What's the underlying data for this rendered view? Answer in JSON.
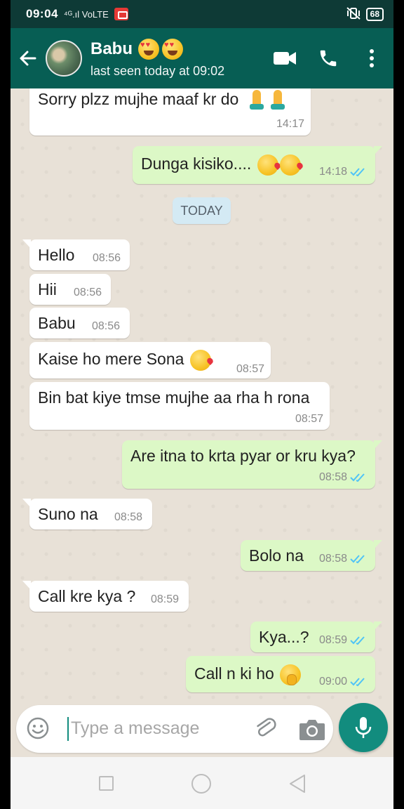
{
  "status_bar": {
    "time": "09:04",
    "network": "⁴ᴳ.ıl VoLTE",
    "battery": "68"
  },
  "header": {
    "contact_name": "Babu",
    "last_seen": "last seen today at 09:02",
    "emojis": [
      "heart-eyes-emoji",
      "heart-eyes-emoji"
    ]
  },
  "chat": {
    "day_separator": "TODAY",
    "messages": [
      {
        "dir": "in",
        "text": "Sorry plzz mujhe maaf kr do",
        "time": "14:17",
        "emoji": "pray"
      },
      {
        "dir": "out",
        "text": "Dunga kisiko....",
        "time": "14:18",
        "emoji": "kiss",
        "read": true
      },
      {
        "dir": "in",
        "text": "Hello",
        "time": "08:56"
      },
      {
        "dir": "in",
        "text": "Hii",
        "time": "08:56"
      },
      {
        "dir": "in",
        "text": "Babu",
        "time": "08:56"
      },
      {
        "dir": "in",
        "text": "Kaise ho mere Sona",
        "time": "08:57",
        "emoji": "kiss"
      },
      {
        "dir": "in",
        "text": "Bin bat kiye tmse mujhe aa rha h rona",
        "time": "08:57"
      },
      {
        "dir": "out",
        "text": "Are itna to krta pyar or kru kya?",
        "time": "08:58",
        "read": true
      },
      {
        "dir": "in",
        "text": "Suno na",
        "time": "08:58"
      },
      {
        "dir": "out",
        "text": "Bolo na",
        "time": "08:58",
        "read": true
      },
      {
        "dir": "in",
        "text": "Call kre kya ?",
        "time": "08:59"
      },
      {
        "dir": "out",
        "text": "Kya...?",
        "time": "08:59",
        "read": true
      },
      {
        "dir": "out",
        "text": "Call n ki ho",
        "time": "09:00",
        "emoji": "shush",
        "read": true
      }
    ]
  },
  "composer": {
    "placeholder": "Type a message"
  },
  "colors": {
    "header": "#075e54",
    "status_bar": "#0e3a36",
    "outgoing_bubble": "#dcf8c6",
    "incoming_bubble": "#ffffff",
    "read_ticks": "#4fc3f7",
    "mic_button": "#128c7e"
  },
  "icons": [
    "back-arrow-icon",
    "video-call-icon",
    "phone-icon",
    "more-options-icon",
    "emoji-icon",
    "attach-icon",
    "camera-icon",
    "mic-icon",
    "nav-recents-icon",
    "nav-home-icon",
    "nav-back-icon"
  ]
}
